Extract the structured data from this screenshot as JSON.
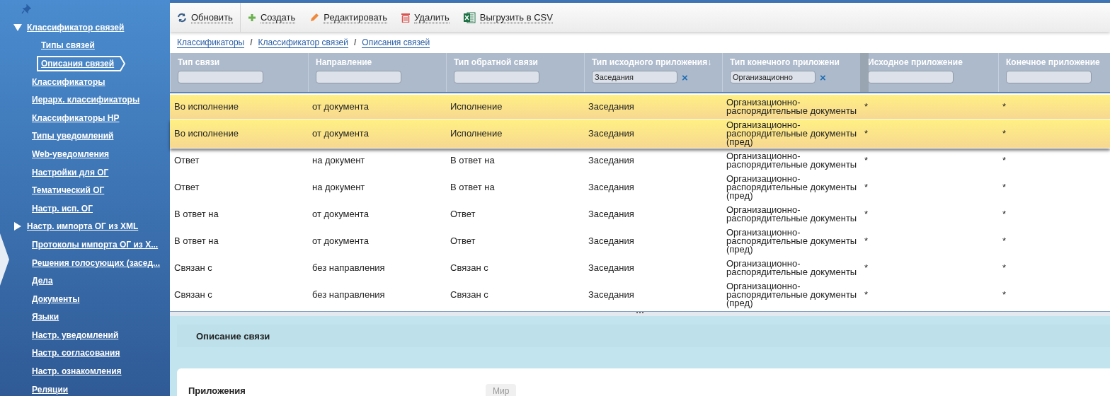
{
  "sidebar": {
    "items": [
      {
        "label": "Классификатор связей",
        "kind": "group",
        "expanded": true,
        "selected": false,
        "children": [
          {
            "label": "Типы связей",
            "selected": false
          },
          {
            "label": "Описания связей",
            "selected": true
          }
        ]
      },
      {
        "label": "Классификаторы",
        "kind": "link",
        "selected": false
      },
      {
        "label": "Иерарх. классификаторы",
        "kind": "link",
        "selected": false
      },
      {
        "label": "Классификаторы НР",
        "kind": "link",
        "selected": false
      },
      {
        "label": "Типы уведомлений",
        "kind": "link",
        "selected": false
      },
      {
        "label": "Web-уведомления",
        "kind": "link",
        "selected": false
      },
      {
        "label": "Настройки для ОГ",
        "kind": "link",
        "selected": false
      },
      {
        "label": "Тематический ОГ",
        "kind": "link",
        "selected": false
      },
      {
        "label": "Настр. исп. ОГ",
        "kind": "link",
        "selected": false
      },
      {
        "label": "Настр. импорта ОГ из XML",
        "kind": "group",
        "expanded": false,
        "selected": false
      },
      {
        "label": "Протоколы импорта ОГ из X...",
        "kind": "link",
        "selected": false
      },
      {
        "label": "Решения голосующих (засед...",
        "kind": "link",
        "selected": false
      },
      {
        "label": "Дела",
        "kind": "link",
        "selected": false
      },
      {
        "label": "Документы",
        "kind": "link",
        "selected": false
      },
      {
        "label": "Языки",
        "kind": "link",
        "selected": false
      },
      {
        "label": "Настр. уведомлений",
        "kind": "link",
        "selected": false
      },
      {
        "label": "Настр. согласования",
        "kind": "link",
        "selected": false
      },
      {
        "label": "Настр. ознакомления",
        "kind": "link",
        "selected": false
      },
      {
        "label": "Реляции",
        "kind": "link",
        "selected": false
      }
    ]
  },
  "toolbar": [
    {
      "label": "Обновить",
      "kind": "refresh"
    },
    {
      "label": "Создать",
      "kind": "create"
    },
    {
      "label": "Редактировать",
      "kind": "edit"
    },
    {
      "label": "Удалить",
      "kind": "delete"
    },
    {
      "label": "Выгрузить в CSV",
      "kind": "excel"
    }
  ],
  "breadcrumbs": {
    "separator": "/",
    "items": [
      "Классификаторы",
      "Классификатор связей",
      "Описания связей"
    ]
  },
  "table": {
    "columns": [
      {
        "title": "Тип связи"
      },
      {
        "title": "Направление"
      },
      {
        "title": "Тип обратной связи"
      },
      {
        "title": "Тип исходного приложения",
        "sort_mark": "↓",
        "filter": "Заседания",
        "clear": "×"
      },
      {
        "title": "Тип конечного приложени",
        "filter": "Организационно",
        "clear": "×"
      },
      {
        "title": "Исходное приложение"
      },
      {
        "title": "Конечное приложение"
      }
    ],
    "rows": [
      {
        "selected": true,
        "cells": [
          "Во исполнение",
          "от документа",
          "Исполнение",
          "Заседания",
          "Организационно-распорядительные документы",
          "*",
          "*"
        ]
      },
      {
        "selected": true,
        "cells": [
          "Во исполнение",
          "от документа",
          "Исполнение",
          "Заседания",
          "Организационно-распорядительные документы (пред)",
          "*",
          "*"
        ]
      },
      {
        "selected": false,
        "cells": [
          "Ответ",
          "на документ",
          "В ответ на",
          "Заседания",
          "Организационно-распорядительные документы",
          "*",
          "*"
        ]
      },
      {
        "selected": false,
        "cells": [
          "Ответ",
          "на документ",
          "В ответ на",
          "Заседания",
          "Организационно-распорядительные документы (пред)",
          "*",
          "*"
        ]
      },
      {
        "selected": false,
        "cells": [
          "В ответ на",
          "от документа",
          "Ответ",
          "Заседания",
          "Организационно-распорядительные документы",
          "*",
          "*"
        ]
      },
      {
        "selected": false,
        "cells": [
          "В ответ на",
          "от документа",
          "Ответ",
          "Заседания",
          "Организационно-распорядительные документы (пред)",
          "*",
          "*"
        ]
      },
      {
        "selected": false,
        "cells": [
          "Связан с",
          "без направления",
          "Связан с",
          "Заседания",
          "Организационно-распорядительные документы",
          "*",
          "*"
        ]
      },
      {
        "selected": false,
        "cells": [
          "Связан с",
          "без направления",
          "Связан с",
          "Заседания",
          "Организационно-распорядительные документы (пред)",
          "*",
          "*"
        ]
      }
    ]
  },
  "detail": {
    "title": "Описание связи",
    "field_label": "Приложения",
    "field_value": "Мир"
  }
}
